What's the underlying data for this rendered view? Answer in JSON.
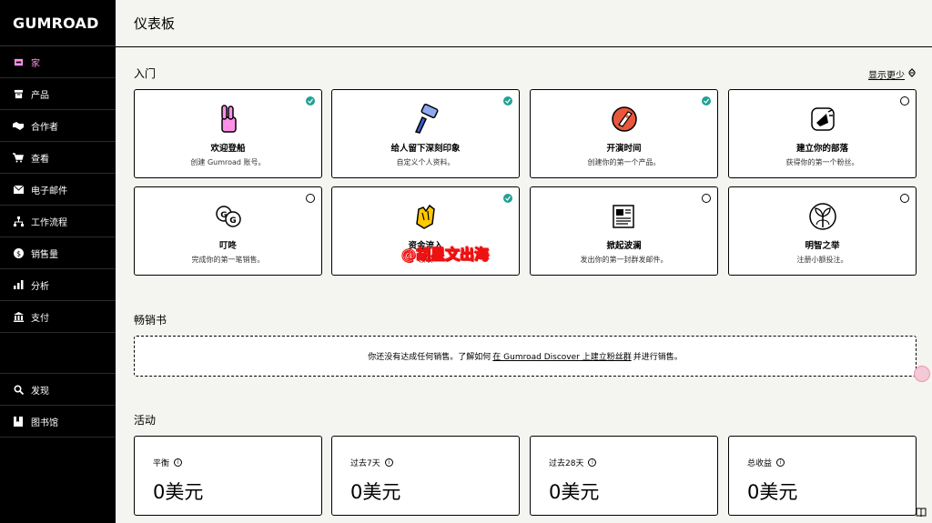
{
  "logo": "GUMROAD",
  "nav": {
    "items": [
      {
        "label": "家",
        "icon": "home-icon"
      },
      {
        "label": "产品",
        "icon": "archive-icon"
      },
      {
        "label": "合作者",
        "icon": "handshake-icon"
      },
      {
        "label": "查看",
        "icon": "cart-icon"
      },
      {
        "label": "电子邮件",
        "icon": "envelope-icon"
      },
      {
        "label": "工作流程",
        "icon": "workflow-icon"
      },
      {
        "label": "销售量",
        "icon": "dollar-icon"
      },
      {
        "label": "分析",
        "icon": "bar-chart-icon"
      },
      {
        "label": "支付",
        "icon": "bank-icon"
      }
    ],
    "bottom_items": [
      {
        "label": "发现",
        "icon": "search-icon"
      },
      {
        "label": "图书馆",
        "icon": "bookmark-icon"
      }
    ]
  },
  "header": {
    "title": "仪表板"
  },
  "getting_started": {
    "title": "入门",
    "toggle_label": "显示更少",
    "cards": [
      {
        "title": "欢迎登船",
        "subtitle": "创建 Gumroad 账号。",
        "done": true,
        "icon": "peace-hand-icon"
      },
      {
        "title": "给人留下深刻印象",
        "subtitle": "自定义个人资料。",
        "done": true,
        "icon": "paintbrush-icon"
      },
      {
        "title": "开演时间",
        "subtitle": "创建你的第一个产品。",
        "done": true,
        "icon": "rocket-icon"
      },
      {
        "title": "建立你的部落",
        "subtitle": "获得你的第一个粉丝。",
        "done": false,
        "icon": "megaphone-icon"
      },
      {
        "title": "叮咚",
        "subtitle": "完成你的第一笔销售。",
        "done": false,
        "icon": "coins-icon"
      },
      {
        "title": "资金流入",
        "subtitle": "领取",
        "done": true,
        "icon": "clapping-hands-icon"
      },
      {
        "title": "掀起波澜",
        "subtitle": "发出你的第一封群发邮件。",
        "done": false,
        "icon": "newspaper-icon"
      },
      {
        "title": "明智之举",
        "subtitle": "注册小额投注。",
        "done": false,
        "icon": "plant-icon"
      }
    ]
  },
  "best_sellers": {
    "title": "畅销书",
    "empty_before": "你还没有达成任何销售。了解如何",
    "empty_link": "在 Gumroad Discover 上建立粉丝群",
    "empty_after": "并进行销售。"
  },
  "activity": {
    "title": "活动",
    "stats": [
      {
        "label": "平衡",
        "value": "0美元"
      },
      {
        "label": "过去7天",
        "value": "0美元"
      },
      {
        "label": "过去28天",
        "value": "0美元"
      },
      {
        "label": "总收益",
        "value": "0美元"
      }
    ]
  },
  "watermark": "@胡星文出海",
  "colors": {
    "accent_pink": "#ff90e8",
    "check_teal": "#23a094"
  }
}
